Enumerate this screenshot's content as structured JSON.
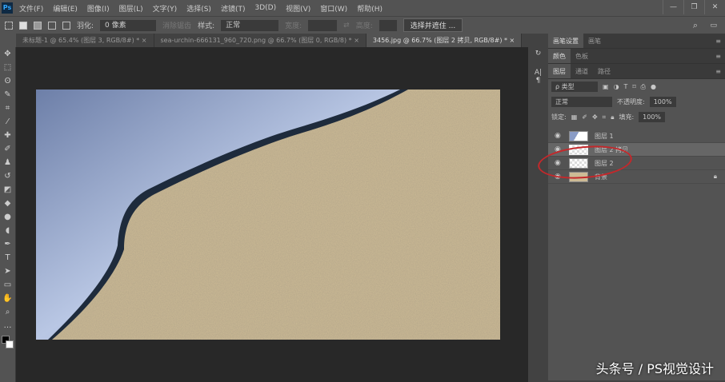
{
  "app": {
    "logo": "Ps"
  },
  "menu": [
    "文件(F)",
    "编辑(E)",
    "图像(I)",
    "图层(L)",
    "文字(Y)",
    "选择(S)",
    "滤镜(T)",
    "3D(D)",
    "视图(V)",
    "窗口(W)",
    "帮助(H)"
  ],
  "window_buttons": [
    "—",
    "❐",
    "✕"
  ],
  "options": {
    "feather_label": "羽化:",
    "feather_value": "0 像素",
    "antialias": "消除锯齿",
    "style_label": "样式:",
    "style_value": "正常",
    "width_label": "宽度:",
    "height_label": "高度:",
    "select_mask": "选择并遮住 ..."
  },
  "tabs": [
    {
      "label": "未标题-1 @ 65.4% (图层 3, RGB/8#) * ×"
    },
    {
      "label": "sea-urchin-666131_960_720.png @ 66.7% (图层 0, RGB/8) * ×"
    },
    {
      "label": "3456.jpg @ 66.7% (图层 2 拷贝, RGB/8#) * ×"
    }
  ],
  "panels": {
    "brush_tabs": [
      "画笔设置",
      "画笔"
    ],
    "color_tabs": [
      "颜色",
      "色板"
    ],
    "layer_tabs": [
      "图层",
      "通道",
      "路径"
    ],
    "filter_kind": "ρ 类型",
    "blend_mode": "正常",
    "opacity_label": "不透明度:",
    "opacity": "100%",
    "lock_label": "锁定:",
    "fill_label": "填充:",
    "fill": "100%",
    "layers": [
      {
        "name": "图层 1"
      },
      {
        "name": "图层 2 拷贝"
      },
      {
        "name": "图层 2"
      },
      {
        "name": "背景"
      }
    ]
  },
  "watermark": "头条号 / PS视觉设计"
}
